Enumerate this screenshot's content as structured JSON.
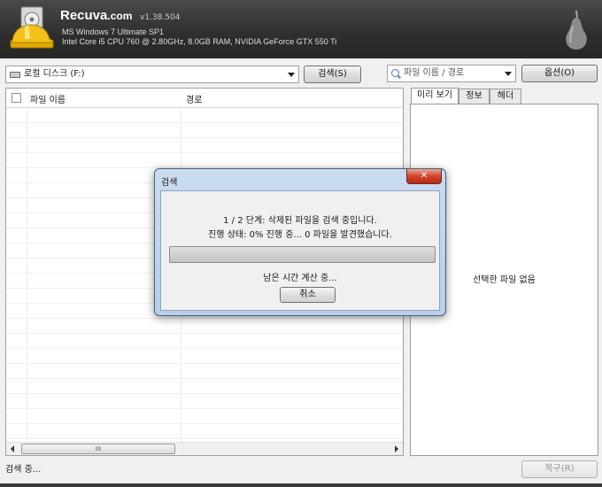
{
  "header": {
    "app_name": "Recuva",
    "app_domain": ".com",
    "version": "v1.38.504",
    "os_line": "MS Windows 7 Ultimate SP1",
    "hw_line": "Intel Core i5 CPU 760 @ 2.80GHz, 8.0GB RAM, NVIDIA GeForce GTX 550 Ti"
  },
  "toolbar": {
    "drive_value": "로컬 디스크 (F:)",
    "scan_label": "검색(S)",
    "filter_placeholder": "파일 이름 / 경로",
    "options_label": "옵션(O)"
  },
  "file_list": {
    "columns": [
      "파일 이름",
      "경로"
    ],
    "rows": [],
    "scroll_thumb_label": "III"
  },
  "tabs": [
    {
      "label": "미리 보기",
      "active": true
    },
    {
      "label": "정보",
      "active": false
    },
    {
      "label": "헤더",
      "active": false
    }
  ],
  "preview": {
    "empty_text": "선택한 파일 없음"
  },
  "status": {
    "text": "검색 중...",
    "recover_label": "복구(R)"
  },
  "dialog": {
    "title": "검색",
    "close_glyph": "✕",
    "stage_text": "1 / 2 단계: 삭제된 파일을 검색 중입니다.",
    "progress_text": "진행 상태: 0% 진행 중... 0 파일을 발견했습니다.",
    "progress_fraction": 0,
    "time_text": "남은 시간 계산 중...",
    "cancel_label": "취소"
  },
  "colors": {
    "header_bg": "#2e2e2e",
    "dialog_frame": "#b8cee8",
    "close_button": "#d0452c"
  }
}
